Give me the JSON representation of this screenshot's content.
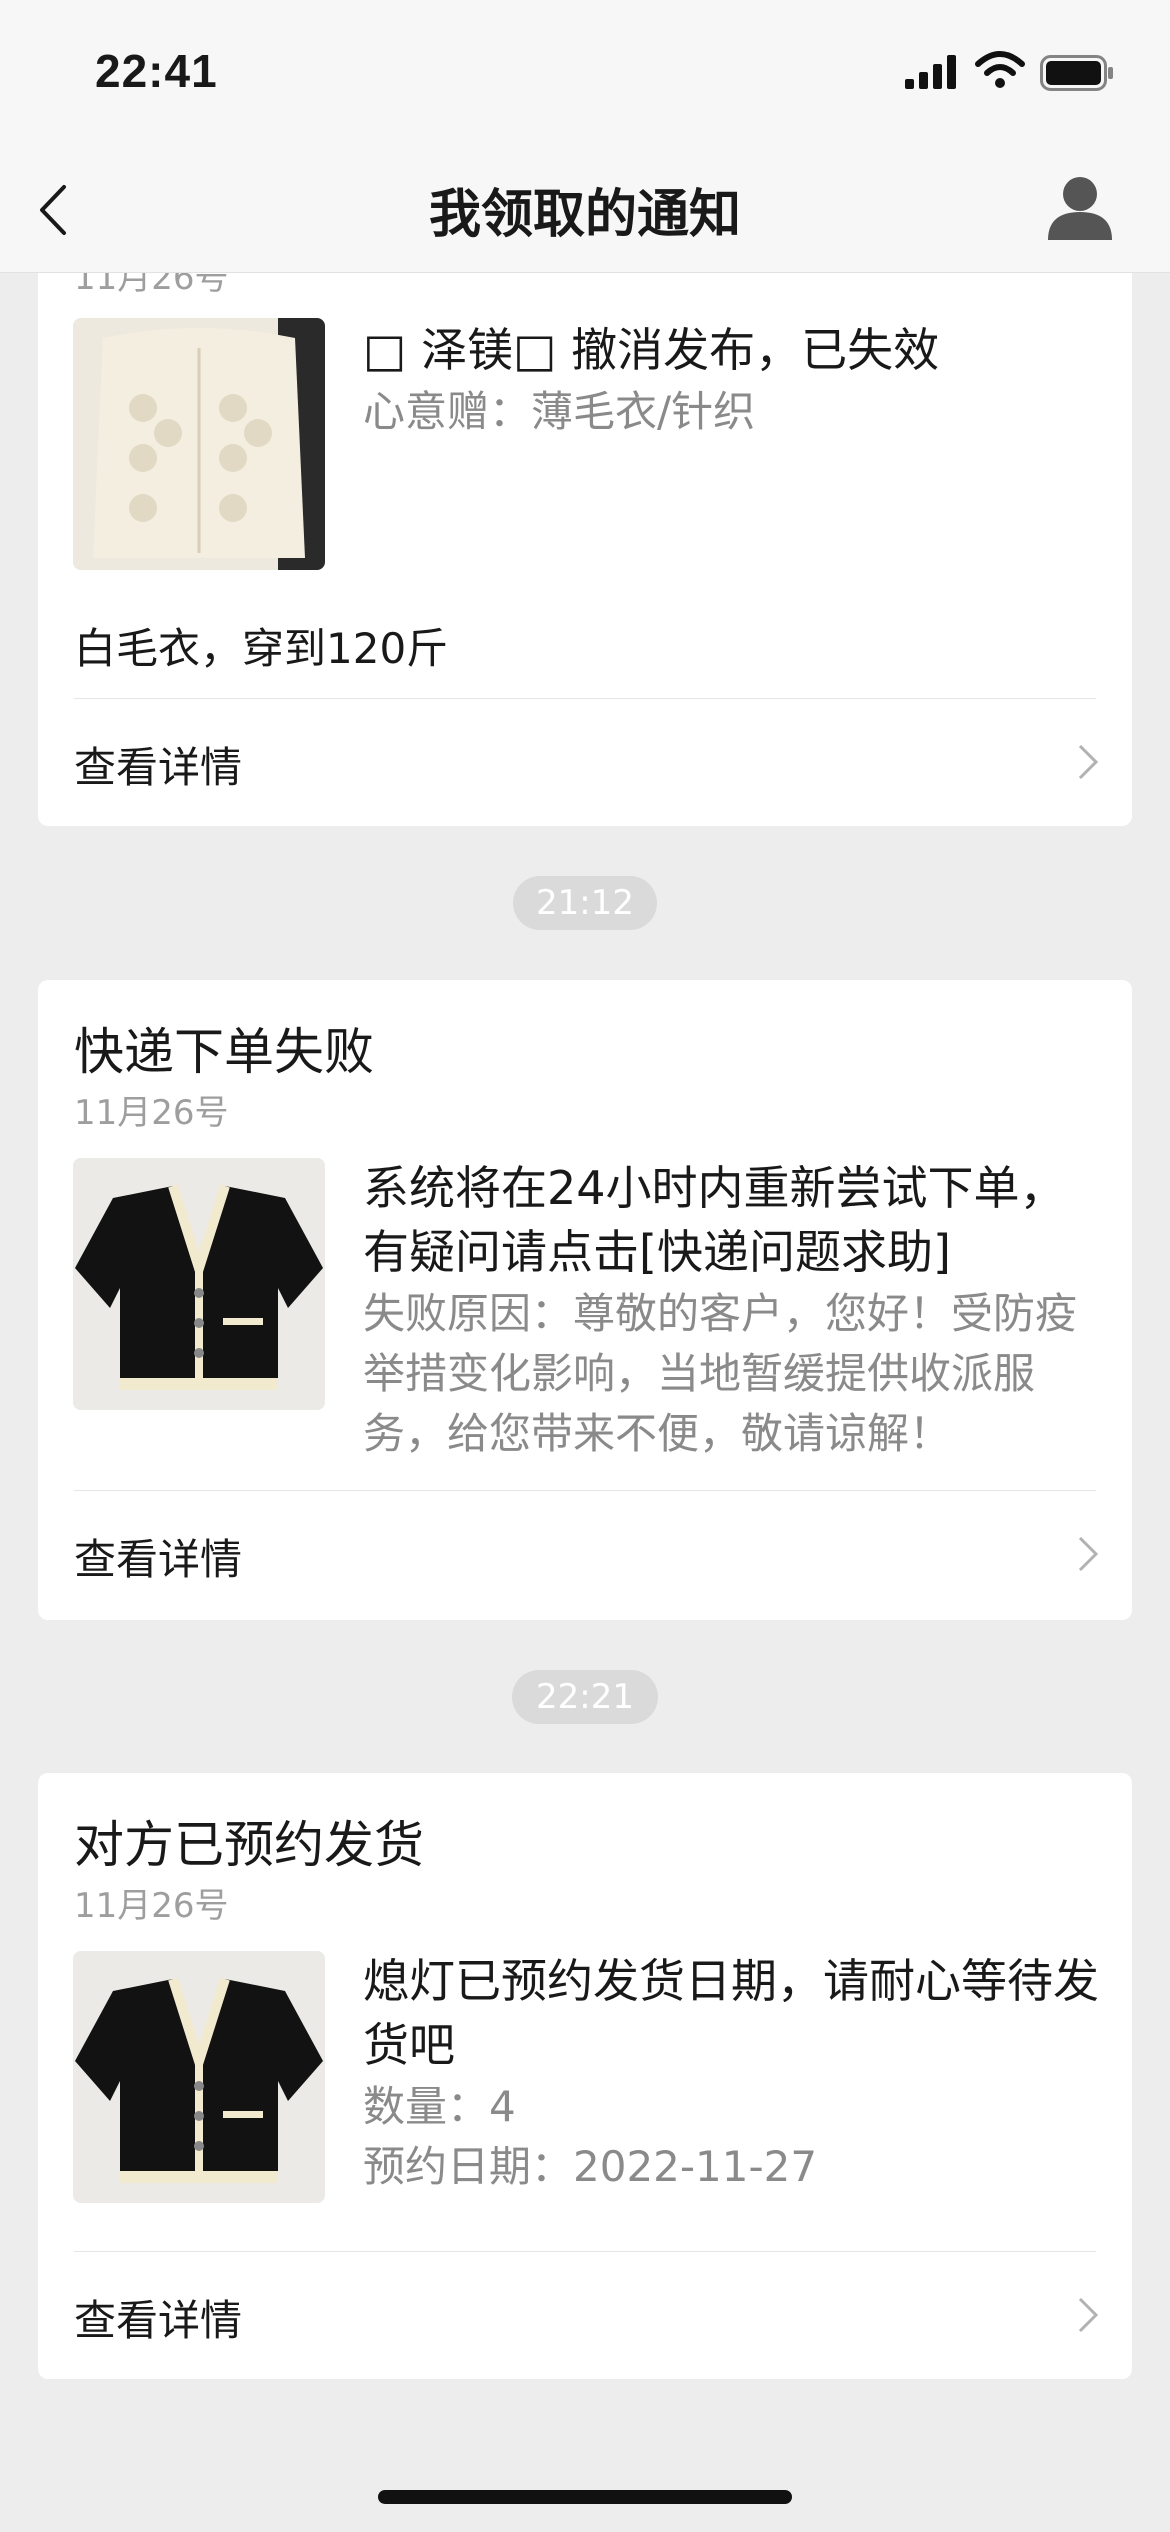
{
  "status_bar": {
    "time": "22:41"
  },
  "nav": {
    "title": "我领取的通知"
  },
  "cards": [
    {
      "date_partial": "11月26号",
      "main": "□ 泽镁□ 撤消发布，已失效",
      "sub": "心意赠：薄毛衣/针织",
      "note": "白毛衣，穿到120斤",
      "detail_label": "查看详情"
    },
    {
      "title": "快递下单失败",
      "date": "11月26号",
      "main": "系统将在24小时内重新尝试下单，有疑问请点击[快递问题求助]",
      "sub": "失败原因：尊敬的客户，您好！受防疫举措变化影响，当地暂缓提供收派服务，给您带来不便，敬请谅解！",
      "detail_label": "查看详情"
    },
    {
      "title": "对方已预约发货",
      "date": "11月26号",
      "main": "熄灯已预约发货日期，请耐心等待发货吧",
      "quantity": "数量：4",
      "appointment": "预约日期：2022-11-27",
      "detail_label": "查看详情"
    }
  ],
  "time_pills": [
    "21:12",
    "22:21"
  ],
  "icons": {
    "back": "chevron-left-icon",
    "avatar": "user-icon",
    "chevron": "chevron-right-icon"
  },
  "colors": {
    "background": "#EDEDED",
    "card": "#FFFFFF",
    "muted": "#8A8A8A",
    "pill": "#DADADA"
  }
}
